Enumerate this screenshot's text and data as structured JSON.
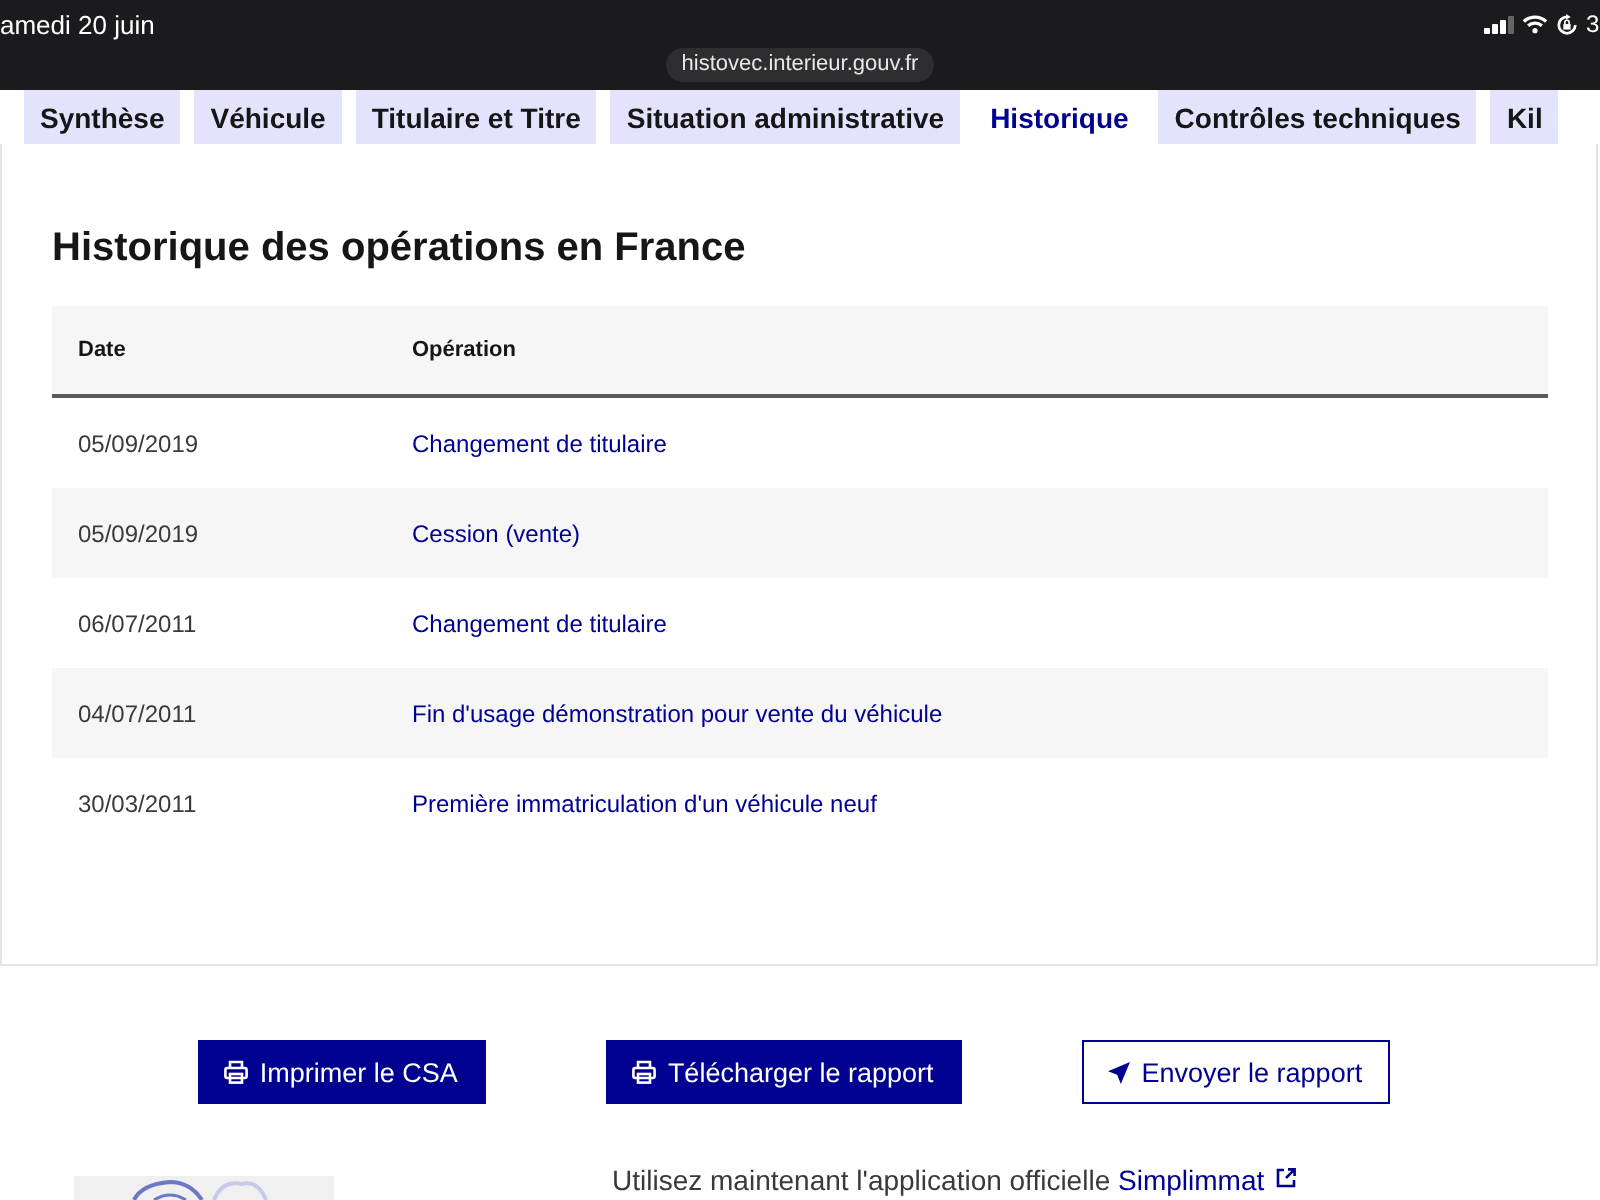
{
  "status_bar": {
    "date": "amedi 20 juin",
    "battery": "3"
  },
  "address_bar": {
    "url": "histovec.interieur.gouv.fr"
  },
  "tabs": [
    {
      "label": "Synthèse",
      "selected": false
    },
    {
      "label": "Véhicule",
      "selected": false
    },
    {
      "label": "Titulaire et Titre",
      "selected": false
    },
    {
      "label": "Situation administrative",
      "selected": false
    },
    {
      "label": "Historique",
      "selected": true
    },
    {
      "label": "Contrôles techniques",
      "selected": false
    },
    {
      "label": "Kil",
      "selected": false
    }
  ],
  "section": {
    "title": "Historique des opérations en France",
    "table": {
      "columns": [
        "Date",
        "Opération"
      ],
      "rows": [
        {
          "date": "05/09/2019",
          "operation": "Changement de titulaire"
        },
        {
          "date": "05/09/2019",
          "operation": "Cession (vente)"
        },
        {
          "date": "06/07/2011",
          "operation": "Changement de titulaire"
        },
        {
          "date": "04/07/2011",
          "operation": "Fin d'usage démonstration pour vente du véhicule"
        },
        {
          "date": "30/03/2011",
          "operation": "Première immatriculation d'un véhicule neuf"
        }
      ]
    }
  },
  "buttons": [
    {
      "label": "Imprimer le CSA",
      "kind": "primary"
    },
    {
      "label": "Télécharger le rapport",
      "kind": "primary"
    },
    {
      "label": "Envoyer le rapport",
      "kind": "secondary"
    }
  ],
  "promo": {
    "text": "Utilisez maintenant l'application officielle",
    "link": "Simplimmat"
  }
}
